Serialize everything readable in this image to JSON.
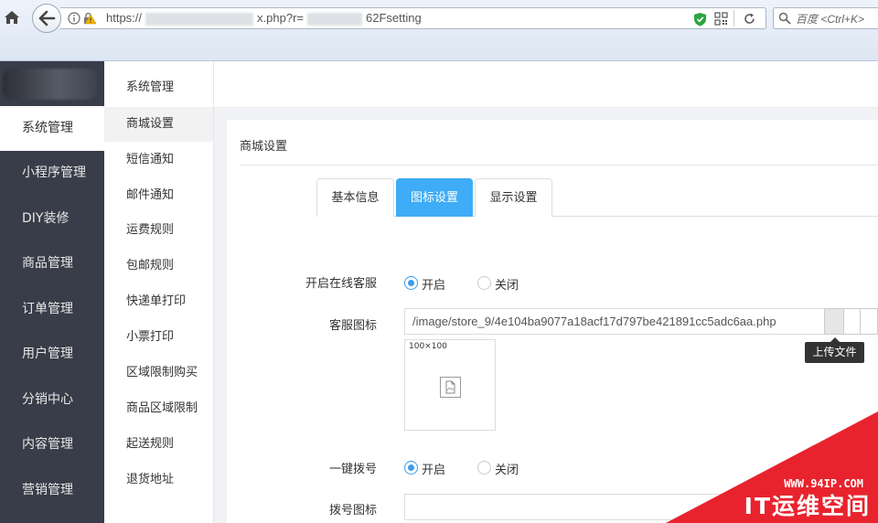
{
  "browser": {
    "url_prefix": "https://",
    "url_mid": "x.php?r=",
    "url_suffix": "62Fsetting",
    "search_placeholder": "百度 <Ctrl+K>"
  },
  "sidebar": {
    "items": [
      "系统管理",
      "小程序管理",
      "DIY装修",
      "商品管理",
      "订单管理",
      "用户管理",
      "分销中心",
      "内容管理",
      "营销管理"
    ],
    "active_index": 0
  },
  "submenu": {
    "title": "系统管理",
    "items": [
      "商城设置",
      "短信通知",
      "邮件通知",
      "运费规则",
      "包邮规则",
      "快递单打印",
      "小票打印",
      "区域限制购买",
      "商品区域限制",
      "起送规则",
      "退货地址"
    ],
    "active_index": 0
  },
  "panel": {
    "title": "商城设置",
    "tabs": [
      "基本信息",
      "图标设置",
      "显示设置"
    ],
    "active_tab": 1
  },
  "form": {
    "online_service_label": "开启在线客服",
    "service_icon_label": "客服图标",
    "service_icon_value": "/image/store_9/4e104ba9077a18acf17d797be421891cc5adc6aa.php",
    "upload_tooltip": "上传文件",
    "thumb_label": "100×100",
    "dial_label": "一键拨号",
    "dial_icon_label": "拨号图标",
    "on_label": "开启",
    "off_label": "关闭"
  },
  "watermark": {
    "url": "WWW.94IP.COM",
    "text": "IT运维空间"
  }
}
